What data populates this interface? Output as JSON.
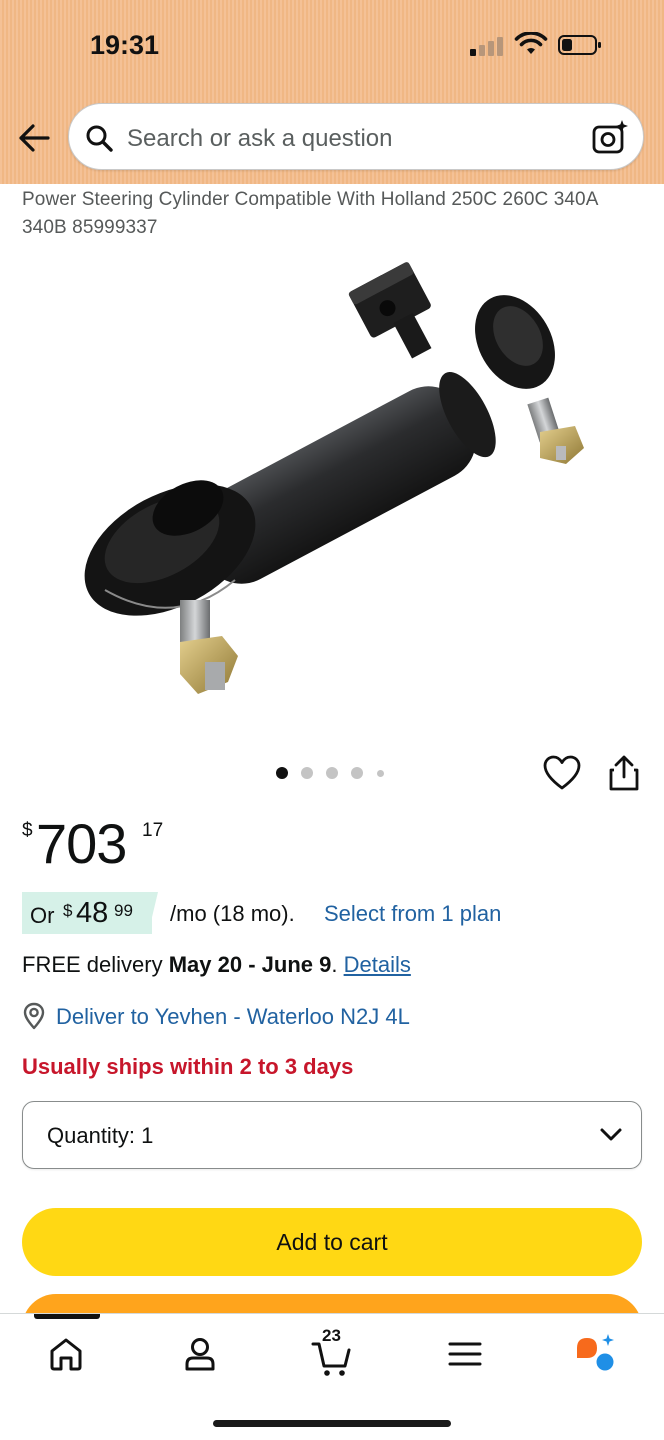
{
  "status_bar": {
    "time": "19:31"
  },
  "search": {
    "placeholder": "Search or ask a question"
  },
  "product": {
    "title": "Power Steering Cylinder Compatible With Holland 250C 260C 340A 340B 85999337",
    "image_dots_count": 5,
    "image_dots_active": 1
  },
  "price": {
    "symbol": "$",
    "whole": "703",
    "fraction": "17"
  },
  "installment": {
    "prefix": "Or",
    "symbol": "$",
    "amount": "48",
    "cents": "99",
    "suffix": "/mo (18 mo).",
    "link": "Select from 1 plan"
  },
  "delivery": {
    "prefix": "FREE delivery",
    "dates": "May 20 - June 9",
    "separator": ".",
    "link": "Details"
  },
  "deliver_to": {
    "text": "Deliver to Yevhen - Waterloo N2J 4L"
  },
  "availability": {
    "text": "Usually ships within 2 to 3 days"
  },
  "quantity": {
    "label": "Quantity:",
    "value": "1"
  },
  "buttons": {
    "add_to_cart": "Add to cart"
  },
  "bottom_nav": {
    "cart_count": "23",
    "items": [
      "home-icon",
      "account-icon",
      "cart-icon",
      "menu-icon",
      "rufus-icon"
    ]
  },
  "colors": {
    "header_bg": "#f4c196",
    "link": "#2162a1",
    "availability": "#c7162b",
    "add_to_cart": "#ffd814",
    "buy_now": "#ffa41c",
    "installment_badge": "#d6f1e8"
  }
}
